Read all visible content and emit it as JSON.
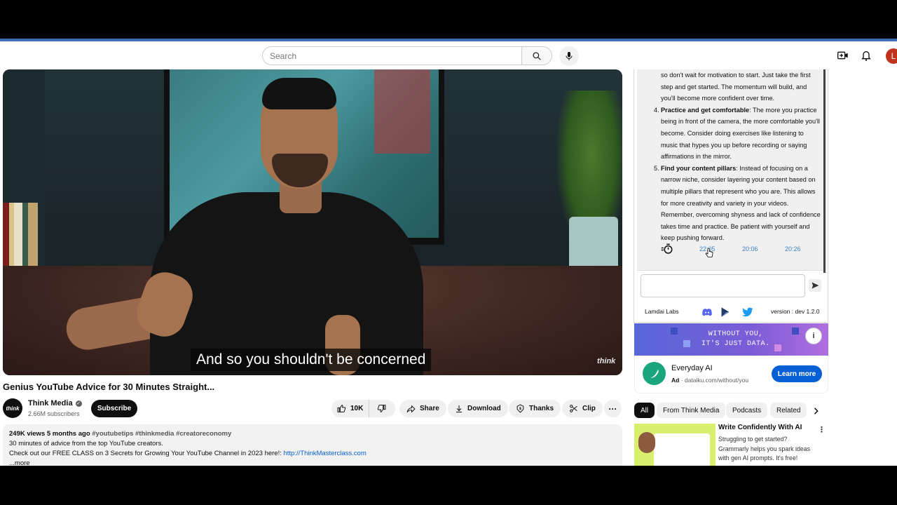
{
  "header": {
    "search_placeholder": "Search",
    "avatar_letter": "L"
  },
  "video": {
    "caption": "And so you shouldn't be concerned",
    "watermark": "think",
    "title": "Genius YouTube Advice for 30 Minutes Straight...",
    "channel_logo_text": "think",
    "channel_name": "Think Media",
    "subscribers": "2.66M subscribers",
    "subscribe_label": "Subscribe",
    "like_count": "10K",
    "share_label": "Share",
    "download_label": "Download",
    "thanks_label": "Thanks",
    "clip_label": "Clip",
    "more_label": "···"
  },
  "description": {
    "stats": "249K views  5 months ago",
    "tags": "#youtubetips #thinkmedia #creatoreconomy",
    "line1": "30 minutes of advice from the top YouTube creators.",
    "line2": "Check out our FREE CLASS on 3 Secrets for Growing Your YouTube Channel in 2023 here!: ",
    "link": "http://ThinkMasterclass.com",
    "more": "...more"
  },
  "extension": {
    "tip_intro": "so don't wait for motivation to start. Just take the first step and get started. The momentum will build, and you'll become more confident over time.",
    "tips": [
      {
        "num": "4.",
        "title": "Practice and get comfortable",
        "text": ": The more you practice being in front of the camera, the more comfortable you'll become. Consider doing exercises like listening to music that hypes you up before recording or saying affirmations in the mirror."
      },
      {
        "num": "5.",
        "title": "Find your content pillars",
        "text": ": Instead of focusing on a narrow niche, consider layering your content based on multiple pillars that represent who you are. This allows for more creativity and variety in your videos. Remember, overcoming shyness and lack of confidence takes time and practice. Be patient with yourself and keep pushing forward."
      }
    ],
    "times": [
      "22:05",
      "20:06",
      "20:26"
    ],
    "footer_brand": "Lamdai Labs",
    "version": "version : dev 1.2.0"
  },
  "ad": {
    "banner_line1": "WITHOUT YOU,",
    "banner_line2": "IT'S JUST DATA.",
    "title": "Everyday AI",
    "ad_label": "Ad",
    "url": "dataiku.com/without/you",
    "cta": "Learn more",
    "info": "i"
  },
  "chips": [
    "All",
    "From Think Media",
    "Podcasts",
    "Related"
  ],
  "recommended": {
    "title": "Write Confidently With AI",
    "desc": "Struggling to get started? Grammarly helps you spark ideas with gen AI prompts. It's free!"
  },
  "colors": {
    "accent_blue": "#065fd4",
    "ext_time_blue": "#3b82c4",
    "avatar_red": "#c0311e",
    "ad_gradient_start": "#5867d8",
    "ad_logo_green": "#19a67d"
  }
}
